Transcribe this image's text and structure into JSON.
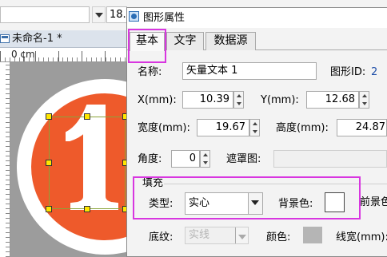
{
  "toolbar": {
    "font_size": "18."
  },
  "document_tab": {
    "title": "未命名-1 *"
  },
  "ruler": {
    "unit_label": "0 cm"
  },
  "canvas": {
    "glyph_text": "1",
    "colors": {
      "disc": "#ee5a2b",
      "ring": "#ffffff",
      "background": "#9c9c9c"
    }
  },
  "dialog": {
    "title": "图形属性",
    "tabs": [
      {
        "label": "基本",
        "active": true
      },
      {
        "label": "文字",
        "active": false
      },
      {
        "label": "数据源",
        "active": false
      }
    ],
    "name_label": "名称:",
    "name_value": "矢量文本 1",
    "id_label": "图形ID:",
    "id_value": "2",
    "x_label": "X(mm):",
    "x_value": "10.39",
    "y_label": "Y(mm):",
    "y_value": "12.68",
    "width_label": "宽度(mm):",
    "width_value": "19.67",
    "height_label": "高度(mm):",
    "height_value": "24.87",
    "angle_label": "角度:",
    "angle_value": "0",
    "mask_label": "遮罩图:",
    "fill_group_label": "填充",
    "type_label": "类型:",
    "type_value": "实心",
    "bg_color_label": "背景色:",
    "fg_color_label": "前景色",
    "pattern_label": "底纹:",
    "pattern_value": "实线",
    "color_label": "颜色:",
    "line_width_label": "线宽(mm):",
    "highlight_color": "#d836e0"
  }
}
